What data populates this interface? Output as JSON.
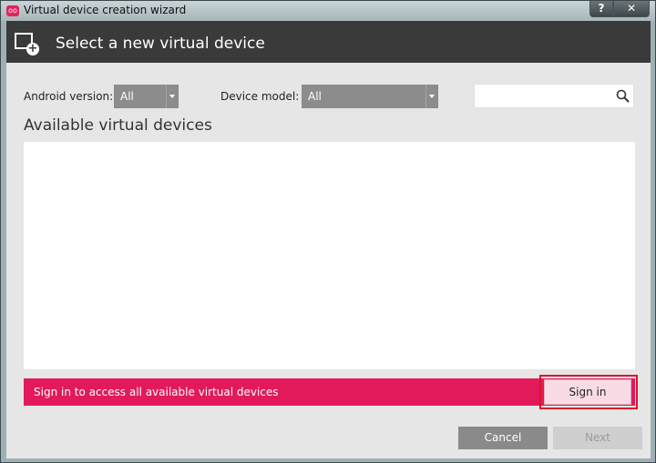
{
  "window": {
    "title": "Virtual device creation wizard",
    "help_label": "?",
    "close_label": "✕",
    "app_icon": "oo"
  },
  "header": {
    "title": "Select a new virtual device",
    "icon": "device-add-icon"
  },
  "filters": {
    "android_version_label": "Android version:",
    "android_version_value": "All",
    "device_model_label": "Device model:",
    "device_model_value": "All",
    "search_placeholder": ""
  },
  "list": {
    "title": "Available virtual devices",
    "items": []
  },
  "banner": {
    "text": "Sign in to access all available virtual devices",
    "signin_label": "Sign in",
    "color": "#e21a5b"
  },
  "footer": {
    "cancel_label": "Cancel",
    "next_label": "Next"
  }
}
